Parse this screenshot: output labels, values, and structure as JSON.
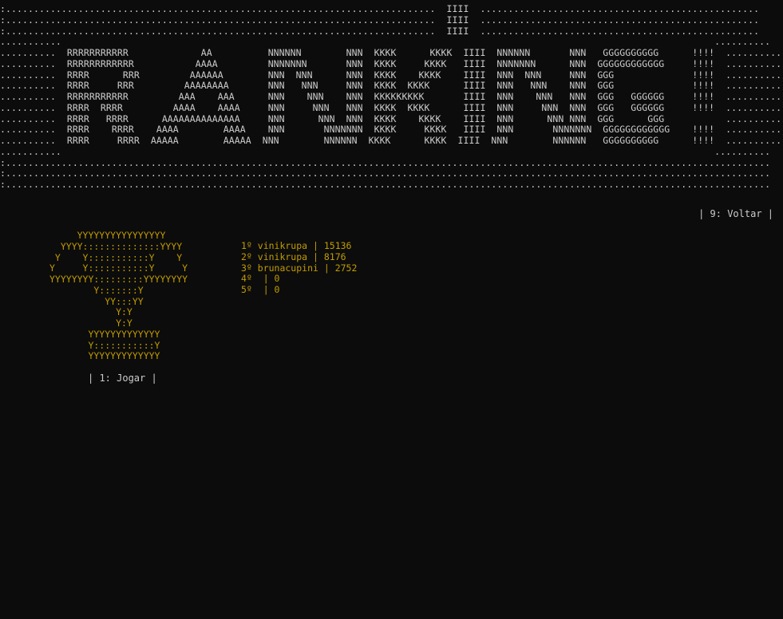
{
  "banner": {
    "lines": [
      ":.............................................................................  IIII  ..................................................",
      ":.............................................................................  IIII  ..................................................",
      ":.............................................................................  IIII  ..................................................",
      "...........                                                                                                                     ..........",
      "..........  RRRRRRRRRRR             AA          NNNNNN        NNN  KKKK      KKKK  IIII  NNNNNN       NNN   GGGGGGGGGG      !!!!  ..........",
      "..........  RRRRRRRRRRRR           AAAA         NNNNNNN       NNN  KKKK     KKKK   IIII  NNNNNNN      NNN  GGGGGGGGGGGG     !!!!  ..........",
      "..........  RRRR      RRR         AAAAAA        NNN  NNN      NNN  KKKK    KKKK    IIII  NNN  NNN     NNN  GGG              !!!!  ..........",
      "..........  RRRR     RRR         AAAAAAAA       NNN   NNN     NNN  KKKK  KKKK      IIII  NNN   NNN    NNN  GGG              !!!!  ..........",
      "..........  RRRRRRRRRRR         AAA    AAA      NNN    NNN    NNN  KKKKKKKKK       IIII  NNN    NNN   NNN  GGG   GGGGGG     !!!!  ..........",
      "..........  RRRR  RRRR         AAAA    AAAA     NNN     NNN   NNN  KKKK  KKKK      IIII  NNN     NNN  NNN  GGG   GGGGGG     !!!!  ..........",
      "..........  RRRR   RRRR      AAAAAAAAAAAAAA     NNN      NNN  NNN  KKKK    KKKK    IIII  NNN      NNN NNN  GGG      GGG           ..........",
      "..........  RRRR    RRRR    AAAA        AAAA    NNN       NNNNNNN  KKKK     KKKK   IIII  NNN       NNNNNNN  GGGGGGGGGGGG    !!!!  ..........",
      "..........  RRRR     RRRR  AAAAA        AAAAA  NNN        NNNNNN  KKKK      KKKK  IIII  NNN        NNNNNN   GGGGGGGGGG      !!!!  ..........",
      "...........                                                                                                                     ..........",
      ":.........................................................................................................................................",
      ":.........................................................................................................................................",
      ":........................................................................................................................................."
    ],
    "text": ""
  },
  "menu": {
    "back": "| 9: Voltar |",
    "play": "| 1: Jogar |"
  },
  "trophy": {
    "lines": [
      "     YYYYYYYYYYYYYYYY",
      "  YYYY::::::::::::::YYYY",
      " Y    Y:::::::::::Y    Y",
      "Y     Y:::::::::::Y     Y",
      "YYYYYYYY:::::::::YYYYYYYY",
      "        Y:::::::Y",
      "          YY:::YY",
      "            Y:Y",
      "            Y:Y",
      "       YYYYYYYYYYYYY",
      "       Y:::::::::::Y",
      "       YYYYYYYYYYYYY"
    ],
    "text": ""
  },
  "ranking": [
    "1º vinikrupa | 15136",
    "2º vinikrupa | 8176",
    "3º brunacupini | 2752",
    "4º  | 0",
    "5º  | 0"
  ],
  "colors": {
    "background": "#0c0c0c",
    "text": "#cccccc",
    "accent": "#c19c00"
  }
}
